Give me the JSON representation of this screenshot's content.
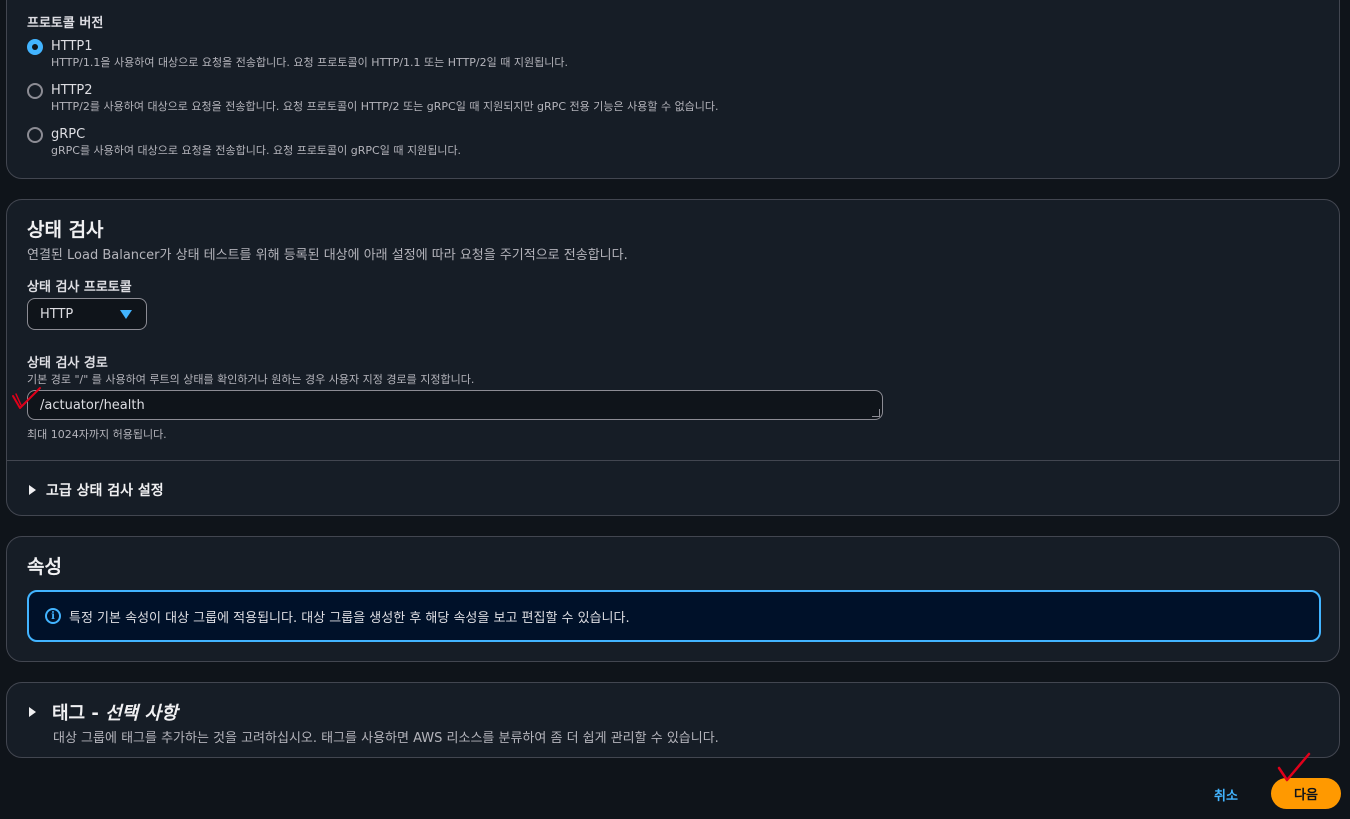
{
  "protocol_version": {
    "label": "프로토콜 버전",
    "options": [
      {
        "title": "HTTP1",
        "desc": "HTTP/1.1을 사용하여 대상으로 요청을 전송합니다. 요청 프로토콜이 HTTP/1.1 또는 HTTP/2일 때 지원됩니다.",
        "checked": true
      },
      {
        "title": "HTTP2",
        "desc": "HTTP/2를 사용하여 대상으로 요청을 전송합니다. 요청 프로토콜이 HTTP/2 또는 gRPC일 때 지원되지만 gRPC 전용 기능은 사용할 수 없습니다.",
        "checked": false
      },
      {
        "title": "gRPC",
        "desc": "gRPC를 사용하여 대상으로 요청을 전송합니다. 요청 프로토콜이 gRPC일 때 지원됩니다.",
        "checked": false
      }
    ]
  },
  "health_check": {
    "title": "상태 검사",
    "description": "연결된 Load Balancer가 상태 테스트를 위해 등록된 대상에 아래 설정에 따라 요청을 주기적으로 전송합니다.",
    "protocol_label": "상태 검사 프로토콜",
    "protocol_value": "HTTP",
    "path_label": "상태 검사 경로",
    "path_hint": "기본 경로 \"/\" 를 사용하여 루트의 상태를 확인하거나 원하는 경우 사용자 지정 경로를 지정합니다.",
    "path_value": "/actuator/health",
    "path_constraint": "최대 1024자까지 허용됩니다.",
    "advanced_label": "고급 상태 검사 설정"
  },
  "attributes": {
    "title": "속성",
    "info_icon": "i",
    "info_text": "특정 기본 속성이 대상 그룹에 적용됩니다. 대상 그룹을 생성한 후 해당 속성을 보고 편집할 수 있습니다."
  },
  "tags": {
    "title": "태그 - ",
    "title_optional": "선택 사항",
    "description": "대상 그룹에 태그를 추가하는 것을 고려하십시오. 태그를 사용하면 AWS 리소스를 분류하여 좀 더 쉽게 관리할 수 있습니다."
  },
  "footer": {
    "cancel_label": "취소",
    "next_label": "다음"
  },
  "colors": {
    "accent": "#42b4ff",
    "primary_button": "#ff9900",
    "annotation": "#e0001a"
  }
}
